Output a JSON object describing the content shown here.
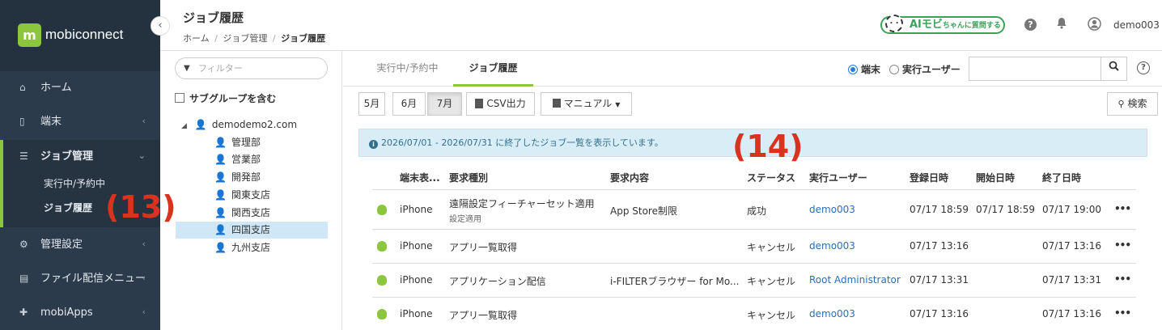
{
  "brand": {
    "logo_letter": "m",
    "name": "mobiconnect",
    "color": "#8cc63f"
  },
  "sidebar": {
    "collapse_icon": "‹",
    "items": [
      {
        "label": "ホーム",
        "icon": "home-icon"
      },
      {
        "label": "端末",
        "icon": "device-icon"
      },
      {
        "label": "ジョブ管理",
        "icon": "job-icon"
      },
      {
        "label": "管理設定",
        "icon": "gear-icon"
      },
      {
        "label": "ファイル配信メニュー",
        "icon": "file-icon"
      },
      {
        "label": "mobiApps",
        "icon": "puzzle-icon"
      }
    ],
    "subitems": [
      {
        "label": "実行中/予約中"
      },
      {
        "label": "ジョブ履歴"
      }
    ]
  },
  "annotations": {
    "a13": "(13)",
    "a14": "(14)"
  },
  "header": {
    "title": "ジョブ履歴",
    "breadcrumb": {
      "home": "ホーム",
      "sep": "/",
      "job_mgmt": "ジョブ管理",
      "current": "ジョブ履歴"
    },
    "ai_button": {
      "main": "AIモビ",
      "small": "ちゃんに質問する",
      "bubble": ". ."
    },
    "user": "demo003"
  },
  "tree": {
    "filter_placeholder": "フィルター",
    "include_subgroups": "サブグループを含む",
    "root": "demodemo2.com",
    "groups": [
      "管理部",
      "営業部",
      "開発部",
      "関東支店",
      "関西支店",
      "四国支店",
      "九州支店"
    ],
    "selected": "四国支店"
  },
  "main": {
    "tabs": [
      "実行中/予約中",
      "ジョブ履歴"
    ],
    "radio": {
      "device": "端末",
      "user": "実行ユーザー",
      "selected": "端末"
    },
    "months": [
      "5月",
      "6月",
      "7月"
    ],
    "csv_label": "CSV出力",
    "manual_label": "マニュアル",
    "search_label": "検索",
    "info_text": "2026/07/01 - 2026/07/31 に終了したジョブ一覧を表示しています。",
    "columns": [
      "端末表...",
      "要求種別",
      "要求内容",
      "ステータス",
      "実行ユーザー",
      "登録日時",
      "開始日時",
      "終了日時"
    ],
    "rows": [
      {
        "device": "iPhone",
        "type": "遠隔設定フィーチャーセット適用",
        "type_sub": "設定適用",
        "content": "App Store制限",
        "status": "成功",
        "user": "demo003",
        "registered": "07/17 18:59",
        "started": "07/17 18:59",
        "ended": "07/17 19:00",
        "more": "•••"
      },
      {
        "device": "iPhone",
        "type": "アプリ一覧取得",
        "type_sub": "",
        "content": "",
        "status": "キャンセル",
        "user": "demo003",
        "registered": "07/17 13:16",
        "started": "",
        "ended": "07/17 13:16",
        "more": "•••"
      },
      {
        "device": "iPhone",
        "type": "アプリケーション配信",
        "type_sub": "",
        "content": "i-FILTERブラウザー for Mo...",
        "status": "キャンセル",
        "user": "Root Administrator",
        "registered": "07/17 13:31",
        "started": "",
        "ended": "07/17 13:31",
        "more": "•••"
      },
      {
        "device": "iPhone",
        "type": "アプリ一覧取得",
        "type_sub": "",
        "content": "",
        "status": "キャンセル",
        "user": "demo003",
        "registered": "07/17 13:16",
        "started": "",
        "ended": "07/17 13:16",
        "more": "•••"
      }
    ]
  }
}
